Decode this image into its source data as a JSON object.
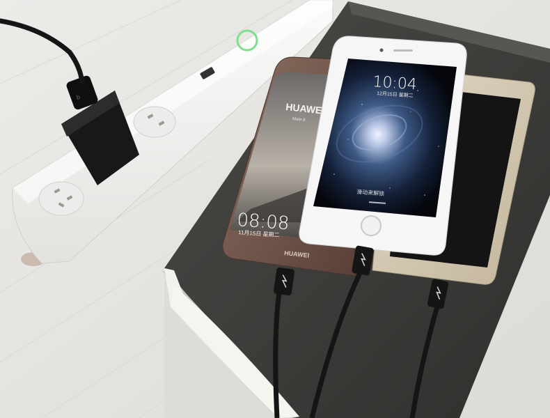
{
  "scene": {
    "palette": {
      "table": "#e7e6e3",
      "power_strip": "#f6f6f4",
      "charger": "#161616",
      "book_cover": "#3f3f3d",
      "book_pages": "#f1f0ec",
      "iphone_body": "#f3f3f3",
      "huawei_mate_body": "#7a5a4d",
      "huawei_gold_body": "#d8cdb8",
      "cable": "#151515",
      "indicator_ring": "#7ee08c"
    },
    "charger_logo": "baseus",
    "power_strip": {
      "indicator": "power-indicator",
      "outlets": 3
    },
    "iphone": {
      "lock_time": "10:04",
      "lock_date": "12月15日 星期二",
      "unlock_text": "滑动来解锁",
      "wallpaper": "galaxy"
    },
    "huawei_mate": {
      "brand_screen": "HUAWEI",
      "brand_subtitle": "Mate 8",
      "lock_time": "08:08",
      "lock_date": "11月15日 星期二",
      "chin_logo": "HUAWEI"
    },
    "huawei_gold": {
      "color": "gold"
    },
    "cables": {
      "count": 3,
      "connector_icon": "lightning-bolt"
    }
  }
}
